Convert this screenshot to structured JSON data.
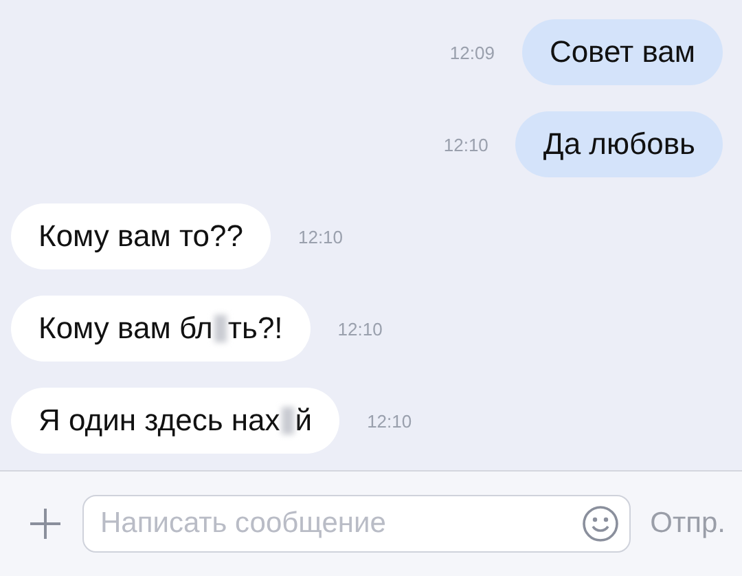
{
  "messages": [
    {
      "outgoing": true,
      "parts": [
        {
          "text": "Совет вам"
        }
      ],
      "time": "12:09"
    },
    {
      "outgoing": true,
      "parts": [
        {
          "text": "Да любовь"
        }
      ],
      "time": "12:10"
    },
    {
      "outgoing": false,
      "parts": [
        {
          "text": "Кому вам то??"
        }
      ],
      "time": "12:10"
    },
    {
      "outgoing": false,
      "parts": [
        {
          "text": "Кому вам бл"
        },
        {
          "kind": "blur"
        },
        {
          "text": "ть?!"
        }
      ],
      "time": "12:10"
    },
    {
      "outgoing": false,
      "parts": [
        {
          "text": "Я один здесь нах"
        },
        {
          "kind": "blur"
        },
        {
          "text": "й"
        }
      ],
      "time": "12:10"
    }
  ],
  "composer": {
    "placeholder": "Написать сообщение",
    "send": "Отпр."
  }
}
